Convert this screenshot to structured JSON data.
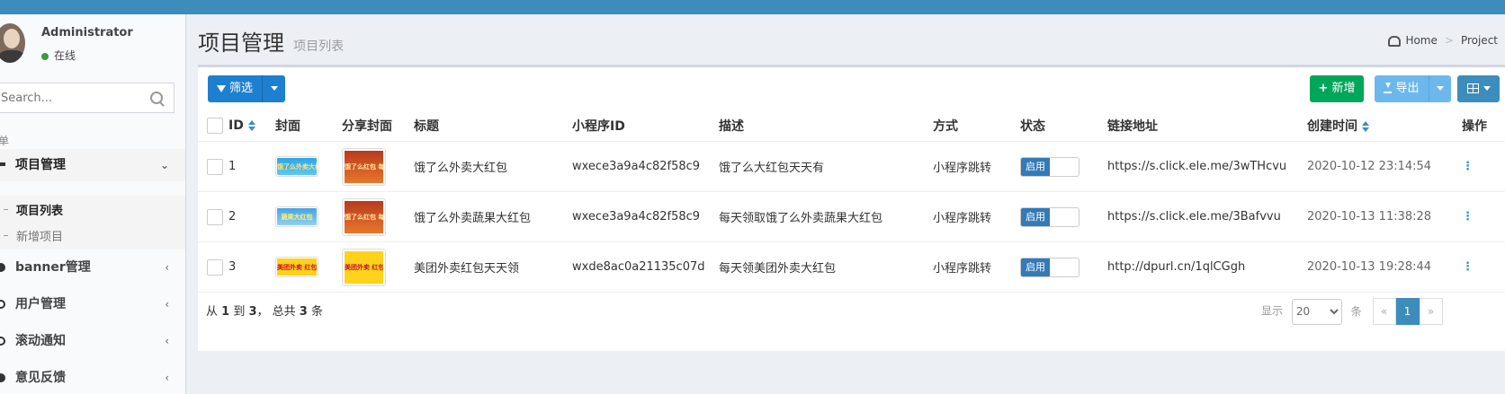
{
  "user": {
    "name": "Administrator",
    "status": "在线"
  },
  "sidebar": {
    "search_placeholder": "Search...",
    "menu_header": "菜单",
    "items": [
      {
        "label": "项目管理",
        "active": true,
        "expanded": true
      },
      {
        "label": "banner管理"
      },
      {
        "label": "用户管理"
      },
      {
        "label": "滚动通知"
      },
      {
        "label": "意见反馈"
      }
    ],
    "sub_items": [
      {
        "label": "项目列表",
        "current": true
      },
      {
        "label": "新增项目"
      }
    ]
  },
  "page": {
    "title": "项目管理",
    "subtitle": "项目列表"
  },
  "breadcrumb": {
    "home": "Home",
    "current": "Project"
  },
  "toolbar": {
    "filter": "筛选",
    "add": "新增",
    "export": "导出"
  },
  "table": {
    "headers": {
      "id": "ID",
      "cover": "封面",
      "share_cover": "分享封面",
      "title": "标题",
      "appid": "小程序ID",
      "desc": "描述",
      "mode": "方式",
      "status": "状态",
      "link": "链接地址",
      "created": "创建时间",
      "actions": "操作"
    },
    "rows": [
      {
        "id": "1",
        "title": "饿了么外卖大红包",
        "appid": "wxece3a9a4c82f58c9",
        "desc": "饿了么大红包天天有",
        "mode": "小程序跳转",
        "status": "启用",
        "link": "https://s.click.ele.me/3wTHcvu",
        "created": "2020-10-12 23:14:54",
        "cover_text": "饿了么外卖大红包",
        "share_text": "饿了么红包 每天领"
      },
      {
        "id": "2",
        "title": "饿了么外卖蔬果大红包",
        "appid": "wxece3a9a4c82f58c9",
        "desc": "每天领取饿了么外卖蔬果大红包",
        "mode": "小程序跳转",
        "status": "启用",
        "link": "https://s.click.ele.me/3Bafvvu",
        "created": "2020-10-13 11:38:28",
        "cover_text": "蔬果大红包",
        "share_text": "饿了么红包 每天领"
      },
      {
        "id": "3",
        "title": "美团外卖红包天天领",
        "appid": "wxde8ac0a21135c07d",
        "desc": "每天领美团外卖大红包",
        "mode": "小程序跳转",
        "status": "启用",
        "link": "http://dpurl.cn/1qlCGgh",
        "created": "2020-10-13 19:28:44",
        "cover_text": "美团外卖 红包人人有",
        "share_text": "美团外卖 红包人人有"
      }
    ]
  },
  "footer": {
    "summary_prefix": "从 ",
    "from": "1",
    "summary_mid1": " 到 ",
    "to": "3",
    "summary_mid2": "， 总共 ",
    "total": "3",
    "summary_suffix": " 条"
  },
  "pager": {
    "show_label": "显示",
    "per_page": "20",
    "unit": "条",
    "prev": "«",
    "page": "1",
    "next": "»"
  },
  "colors": {
    "topbar": "#3c8dbc",
    "primary": "#1d7fd0",
    "success": "#00a65a",
    "export": "#6cb8ec"
  }
}
